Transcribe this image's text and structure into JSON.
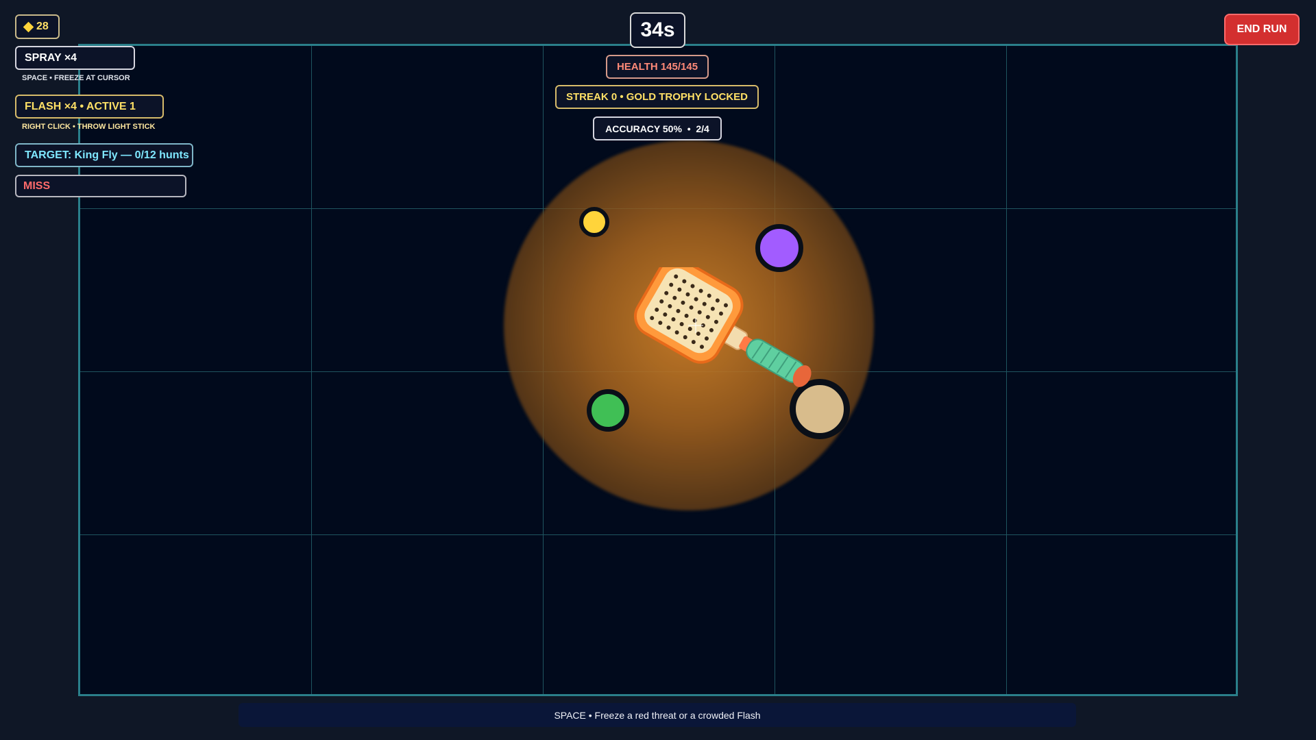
{
  "hud": {
    "coins": "28",
    "spray_label": "SPRAY ×4",
    "spray_hint": "SPACE • FREEZE AT CURSOR",
    "flash_label": "FLASH ×4 • ACTIVE 1",
    "flash_hint": "RIGHT CLICK • THROW LIGHT STICK",
    "target_label": "TARGET: King Fly — 0/12 hunts",
    "miss_label": "MISS",
    "timer": "34s",
    "health": "HEALTH 145/145",
    "streak": "STREAK 0 • GOLD TROPHY LOCKED",
    "accuracy": "ACCURACY 50%  •  2/4"
  },
  "controls": {
    "end_run_label": "END RUN"
  },
  "hint_bar": {
    "text": "SPACE • Freeze a red threat or a crowded Flash"
  },
  "bugs": [
    {
      "kind": "yellow-bug",
      "color": "#ffd43b"
    },
    {
      "kind": "purple-bug",
      "color": "#a25cff"
    },
    {
      "kind": "green-bug",
      "color": "#40bf55"
    },
    {
      "kind": "tan-bug",
      "color": "#d8bc8c"
    }
  ],
  "colors": {
    "background": "#0f1726",
    "arena": "#010a1c",
    "arena_border": "#2a7f8a",
    "accent_gold": "#ffe066",
    "accent_cyan": "#7fe7ff",
    "danger": "#d32f2f"
  },
  "icons": {
    "coin": "diamond-icon",
    "cursor": "fly-swatter-icon"
  }
}
